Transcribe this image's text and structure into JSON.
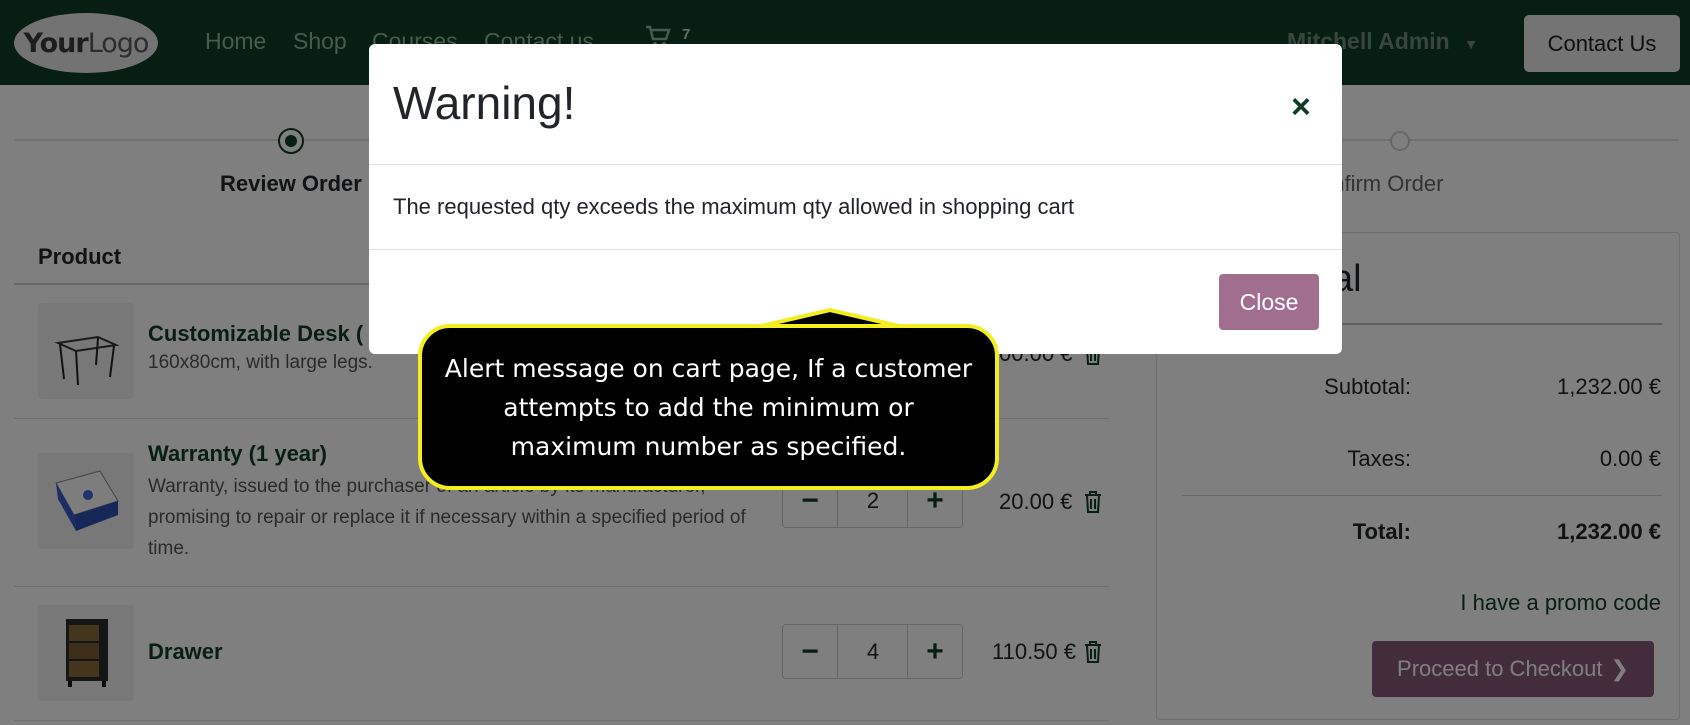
{
  "navbar": {
    "logo_part1": "Your",
    "logo_part2": "Logo",
    "links": [
      "Home",
      "Shop",
      "Courses",
      "Contact us"
    ],
    "cart_count": "7",
    "user_name": "Mitchell Admin",
    "contact_button": "Contact Us",
    "bg_color": "#0e3d25"
  },
  "steps": {
    "step1": "Review Order",
    "step3": "onfirm Order"
  },
  "table": {
    "header_product": "Product",
    "rows": [
      {
        "name": "Customizable Desk (",
        "desc": "160x80cm, with large legs.",
        "qty": "",
        "price": "00.00 €",
        "image_icon": "desk-icon"
      },
      {
        "name": "Warranty (1 year)",
        "desc": "Warranty, issued to the purchaser of an article by its manufacturer, promising to repair or replace it if necessary within a specified period of time.",
        "qty": "2",
        "price": "20.00 €",
        "image_icon": "warranty-box-icon"
      },
      {
        "name": "Drawer",
        "desc": "",
        "qty": "4",
        "price": "110.50 €",
        "image_icon": "drawer-icon"
      }
    ]
  },
  "summary": {
    "title_fragment": "al",
    "subtotal_label": "Subtotal:",
    "subtotal_value": "1,232.00 €",
    "taxes_label": "Taxes:",
    "taxes_value": "0.00 €",
    "total_label": "Total:",
    "total_value": "1,232.00 €",
    "promo_link": "I have a promo code",
    "checkout_button": "Proceed to Checkout"
  },
  "modal": {
    "title": "Warning!",
    "message": "The requested qty exceeds the maximum qty allowed in shopping cart",
    "close_button": "Close",
    "close_icon": "×",
    "accent_color": "#a26e8f"
  },
  "callout": {
    "text": "Alert message on cart page, If a customer attempts to add the minimum or maximum number as specified.",
    "border_color": "#f2ee20"
  }
}
